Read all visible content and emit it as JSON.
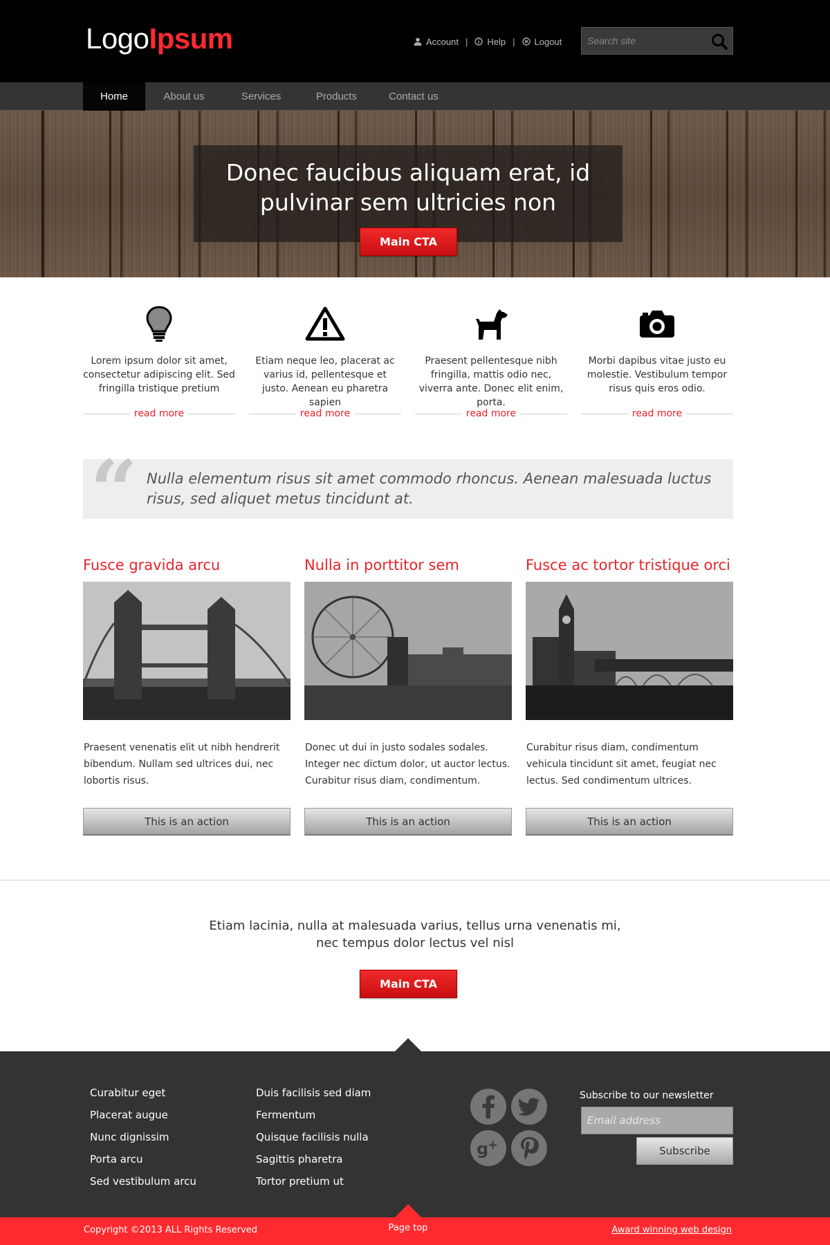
{
  "header": {
    "logo_part1": "Logo",
    "logo_part2": "Ipsum",
    "links": [
      {
        "label": "Account",
        "icon": "user-icon"
      },
      {
        "label": "Help",
        "icon": "info-icon"
      },
      {
        "label": "Logout",
        "icon": "close-circle-icon"
      }
    ],
    "search_placeholder": "Search site"
  },
  "nav": {
    "items": [
      "Home",
      "About us",
      "Services",
      "Products",
      "Contact us"
    ],
    "active": "Home"
  },
  "hero": {
    "title": "Donec faucibus aliquam erat, id pulvinar sem ultricies non",
    "cta": "Main CTA"
  },
  "features": [
    {
      "icon": "lightbulb-icon",
      "text": "Lorem ipsum dolor sit amet, consectetur adipiscing elit. Sed fringilla tristique pretium",
      "link": "read more"
    },
    {
      "icon": "warning-icon",
      "text": "Etiam neque leo, placerat ac varius id, pellentesque et justo. Aenean eu pharetra sapien",
      "link": "read more"
    },
    {
      "icon": "dog-icon",
      "text": "Praesent pellentesque nibh fringilla, mattis odio nec, viverra ante. Donec elit enim, porta.",
      "link": "read more"
    },
    {
      "icon": "camera-icon",
      "text": "Morbi dapibus vitae justo eu molestie. Vestibulum tempor risus quis eros odio.",
      "link": "read more"
    }
  ],
  "quote": {
    "text": "Nulla elementum risus sit amet commodo rhoncus. Aenean malesuada luctus risus, sed aliquet metus tincidunt at."
  },
  "columns": [
    {
      "title": "Fusce gravida arcu",
      "image": "tower-bridge-photo",
      "text": "Praesent venenatis elit ut nibh hendrerit bibendum. Nullam sed ultrices dui, nec lobortis risus.",
      "button": "This is an action"
    },
    {
      "title": "Nulla in porttitor sem",
      "image": "london-eye-photo",
      "text": "Donec ut dui in justo sodales sodales. Integer nec dictum dolor, ut auctor lectus. Curabitur risus diam, condimentum.",
      "button": "This is an action"
    },
    {
      "title": "Fusce ac tortor tristique orci",
      "image": "big-ben-photo",
      "text": "Curabitur risus diam, condimentum vehicula tincidunt sit amet, feugiat nec lectus. Sed condimentum ultrices.",
      "button": "This is an action"
    }
  ],
  "cta_section": {
    "text": "Etiam lacinia, nulla at malesuada varius, tellus urna venenatis mi, nec tempus dolor lectus vel nisl",
    "cta": "Main CTA"
  },
  "footer": {
    "links_col1": [
      "Curabitur eget",
      "Placerat augue",
      "Nunc dignissim",
      "Porta arcu",
      "Sed vestibulum arcu"
    ],
    "links_col2": [
      "Duis facilisis sed diam",
      "Fermentum",
      "Quisque facilisis nulla",
      "Sagittis pharetra",
      "Tortor pretium ut"
    ],
    "social": [
      "facebook-icon",
      "twitter-icon",
      "google-plus-icon",
      "pinterest-icon"
    ],
    "newsletter_label": "Subscribe to our newsletter",
    "newsletter_placeholder": "Email address",
    "subscribe": "Subscribe"
  },
  "bottombar": {
    "copyright": "Copyright  ©2013 ALL Rights Reserved",
    "page_top": "Page top",
    "award": "Award winning web design"
  },
  "colors": {
    "accent": "#ff2a2f",
    "header_bg": "#000000",
    "nav_bg": "#343434",
    "footer_bg": "#333333"
  }
}
